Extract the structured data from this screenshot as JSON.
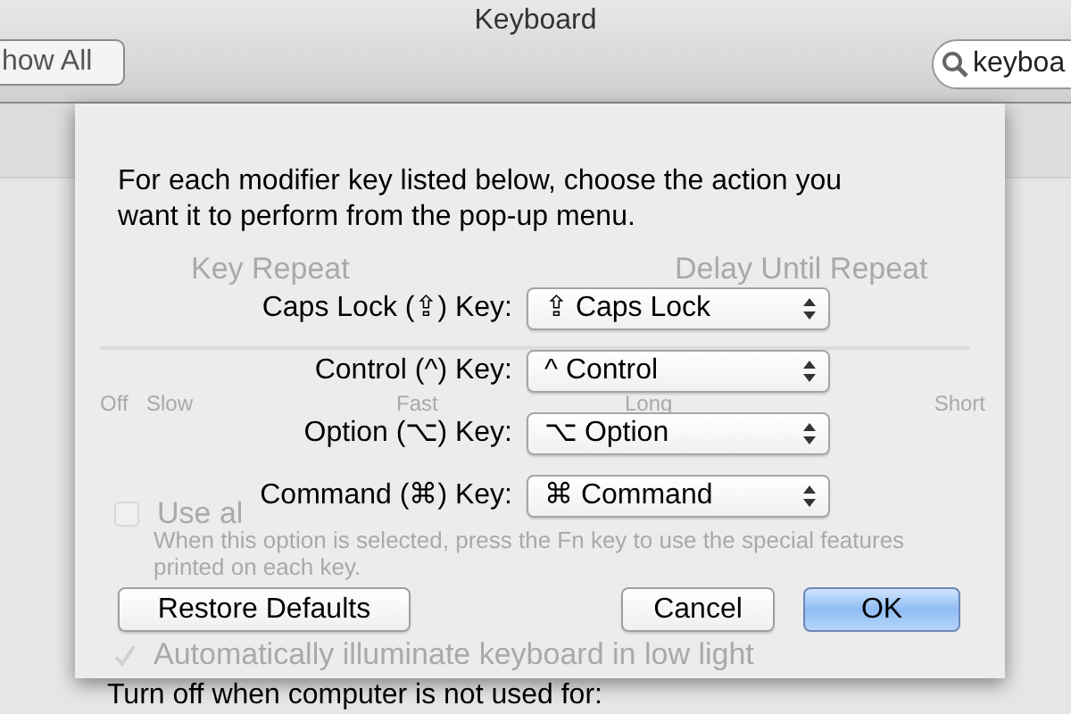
{
  "window": {
    "title": "Keyboard"
  },
  "toolbar": {
    "show_all_button": "how All",
    "search": {
      "value": "keyboa"
    }
  },
  "background": {
    "key_repeat": {
      "title": "Key Repeat",
      "labels": [
        "Off",
        "Slow",
        "Fast"
      ]
    },
    "delay_until_repeat": {
      "title": "Delay Until Repeat",
      "labels": [
        "Long",
        "Short"
      ]
    },
    "fn_keys": {
      "label": "Use al",
      "checked": false,
      "note": "When this option is selected, press the Fn key to use the special features printed on each key."
    },
    "illuminate": {
      "label": "Automatically illuminate keyboard in low light",
      "checked": true
    }
  },
  "sheet": {
    "message": "For each modifier key listed below, choose the action you want it to perform from the pop-up menu.",
    "modifier_keys": [
      {
        "label": "Caps Lock (⇪) Key:",
        "value": "⇪ Caps Lock"
      },
      {
        "label": "Control (^) Key:",
        "value": "^ Control"
      },
      {
        "label": "Option (⌥) Key:",
        "value": "⌥ Option"
      },
      {
        "label": "Command (⌘) Key:",
        "value": "⌘ Command"
      }
    ],
    "buttons": [
      {
        "label": "Restore Defaults",
        "kind": "normal"
      },
      {
        "label": "Cancel",
        "kind": "normal"
      },
      {
        "label": "OK",
        "kind": "default"
      }
    ]
  },
  "footer_text": "Turn off when computer is not used for:"
}
